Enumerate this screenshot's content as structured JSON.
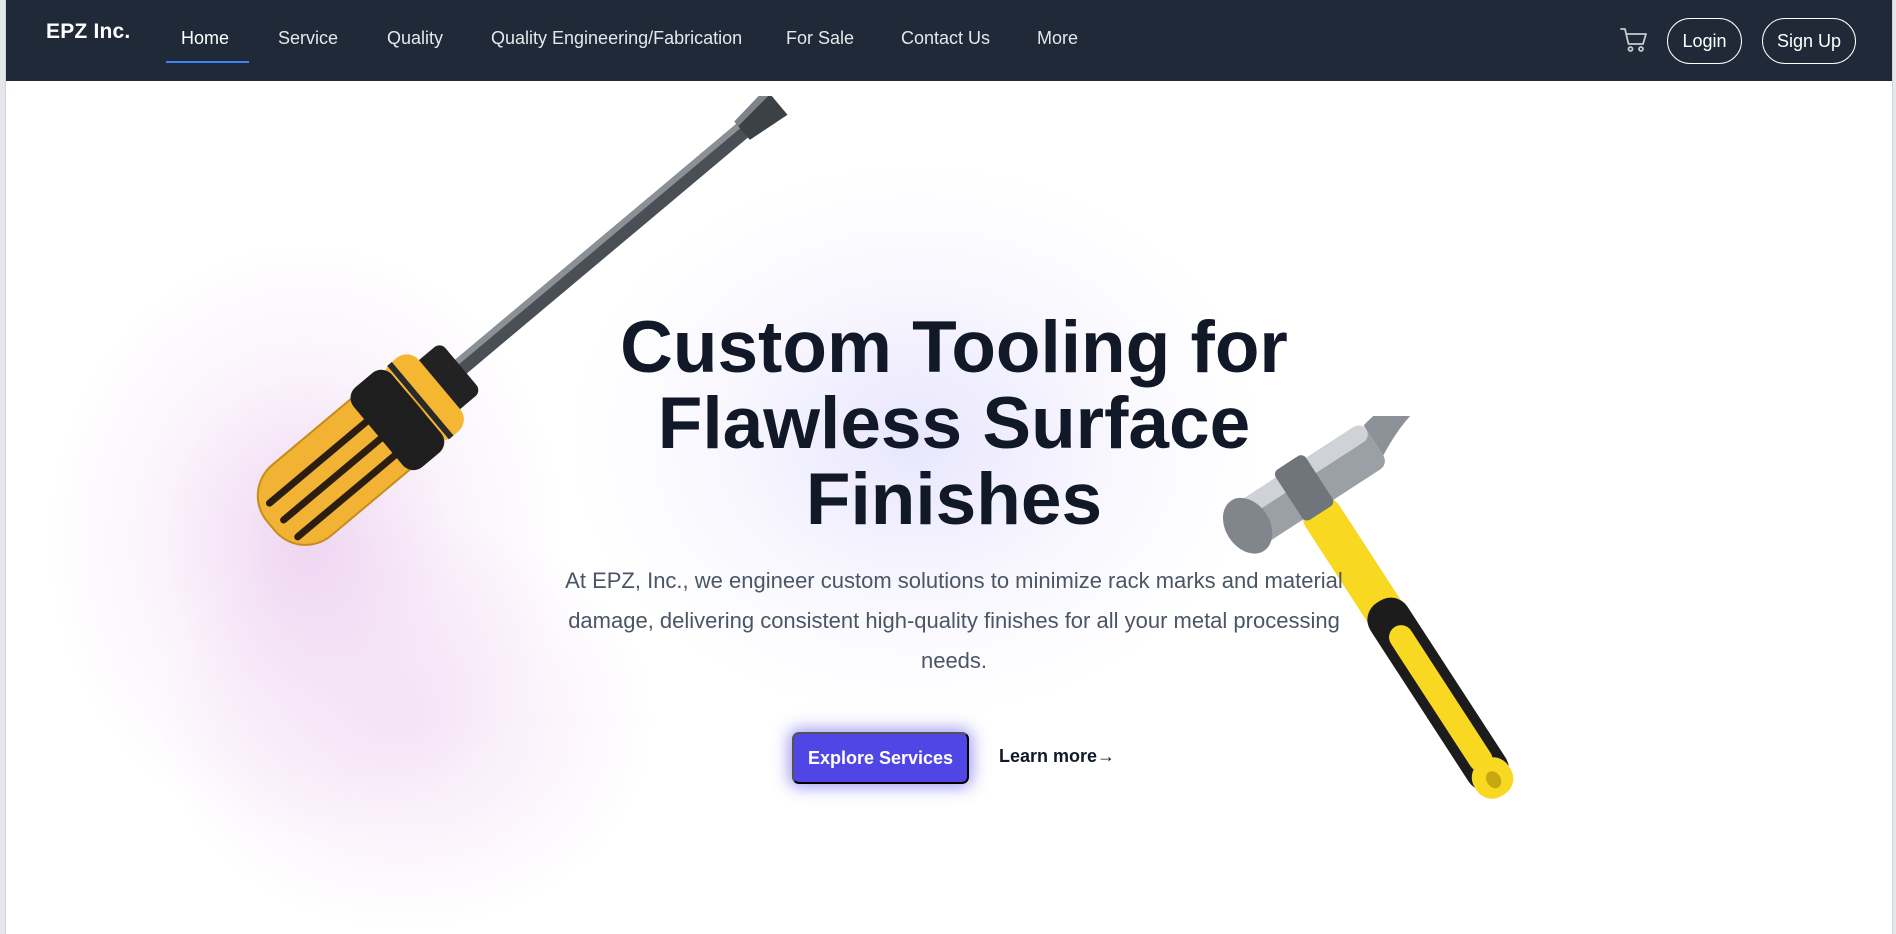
{
  "header": {
    "logo": "EPZ Inc.",
    "nav": [
      {
        "label": "Home",
        "active": true
      },
      {
        "label": "Service"
      },
      {
        "label": "Quality"
      },
      {
        "label": "Quality Engineering/Fabrication"
      },
      {
        "label": "For Sale"
      },
      {
        "label": "Contact Us"
      },
      {
        "label": "More"
      }
    ],
    "cart_icon": "cart-icon",
    "login_label": "Login",
    "signup_label": "Sign Up"
  },
  "hero": {
    "title_lines": [
      "Custom Tooling for",
      "Flawless Surface",
      "Finishes"
    ],
    "subtitle": "At EPZ, Inc., we engineer custom solutions to minimize rack marks and material damage, delivering consistent high-quality finishes for all your metal processing needs.",
    "cta_label": "Explore Services",
    "learn_more_label": "Learn more→",
    "images": [
      "screwdriver-image",
      "hammer-image"
    ]
  },
  "colors": {
    "navbar_bg": "#1f2937",
    "accent": "#4f46e5",
    "active_underline": "#3b82f6",
    "title_text": "#111827",
    "body_text": "#4b5563"
  }
}
